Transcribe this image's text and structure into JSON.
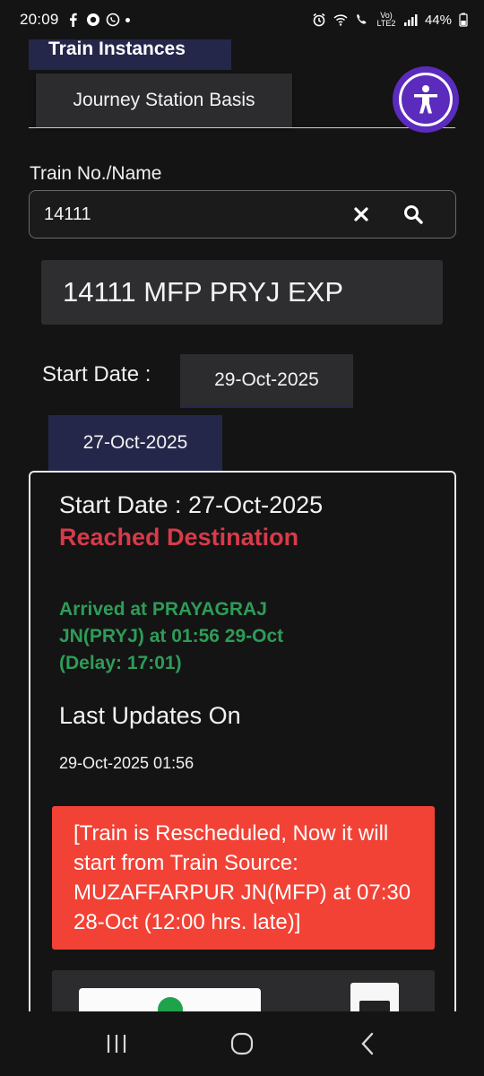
{
  "status_bar": {
    "time": "20:09",
    "network": "Vo) LTE2",
    "battery": "44%"
  },
  "tabs": {
    "train_instances": "Train Instances",
    "journey_station": "Journey Station Basis"
  },
  "search": {
    "label": "Train No./Name",
    "value": "14111"
  },
  "result": {
    "train": "14111 MFP PRYJ EXP"
  },
  "start_date": {
    "label": "Start Date :",
    "dates": [
      "29-Oct-2025",
      "27-Oct-2025"
    ]
  },
  "card": {
    "start_date_text": "Start Date : 27-Oct-2025",
    "status": "Reached Destination",
    "arrived": "Arrived at PRAYAGRAJ JN(PRYJ) at 01:56 29-Oct (Delay: 17:01)",
    "last_updates_title": "Last Updates On",
    "last_updates_value": "29-Oct-2025 01:56",
    "alert": "[Train is Rescheduled, Now it will start from Train Source: MUZAFFARPUR JN(MFP) at 07:30 28-Oct (12:00 hrs. late)]"
  },
  "colors": {
    "background": "#141414",
    "selected_tab": "#25274a",
    "reached": "#d83a4a",
    "arrived": "#2e9c58",
    "alert": "#f24236",
    "accessibility": "#5b2bbd"
  },
  "icons": [
    "facebook-icon",
    "circle-app-icon",
    "whatsapp-icon",
    "alarm-icon",
    "wifi-call-icon",
    "call-signal-icon",
    "signal-icon",
    "battery-icon",
    "accessibility-icon",
    "clear-icon",
    "search-icon",
    "recents-icon",
    "home-icon",
    "back-icon"
  ]
}
